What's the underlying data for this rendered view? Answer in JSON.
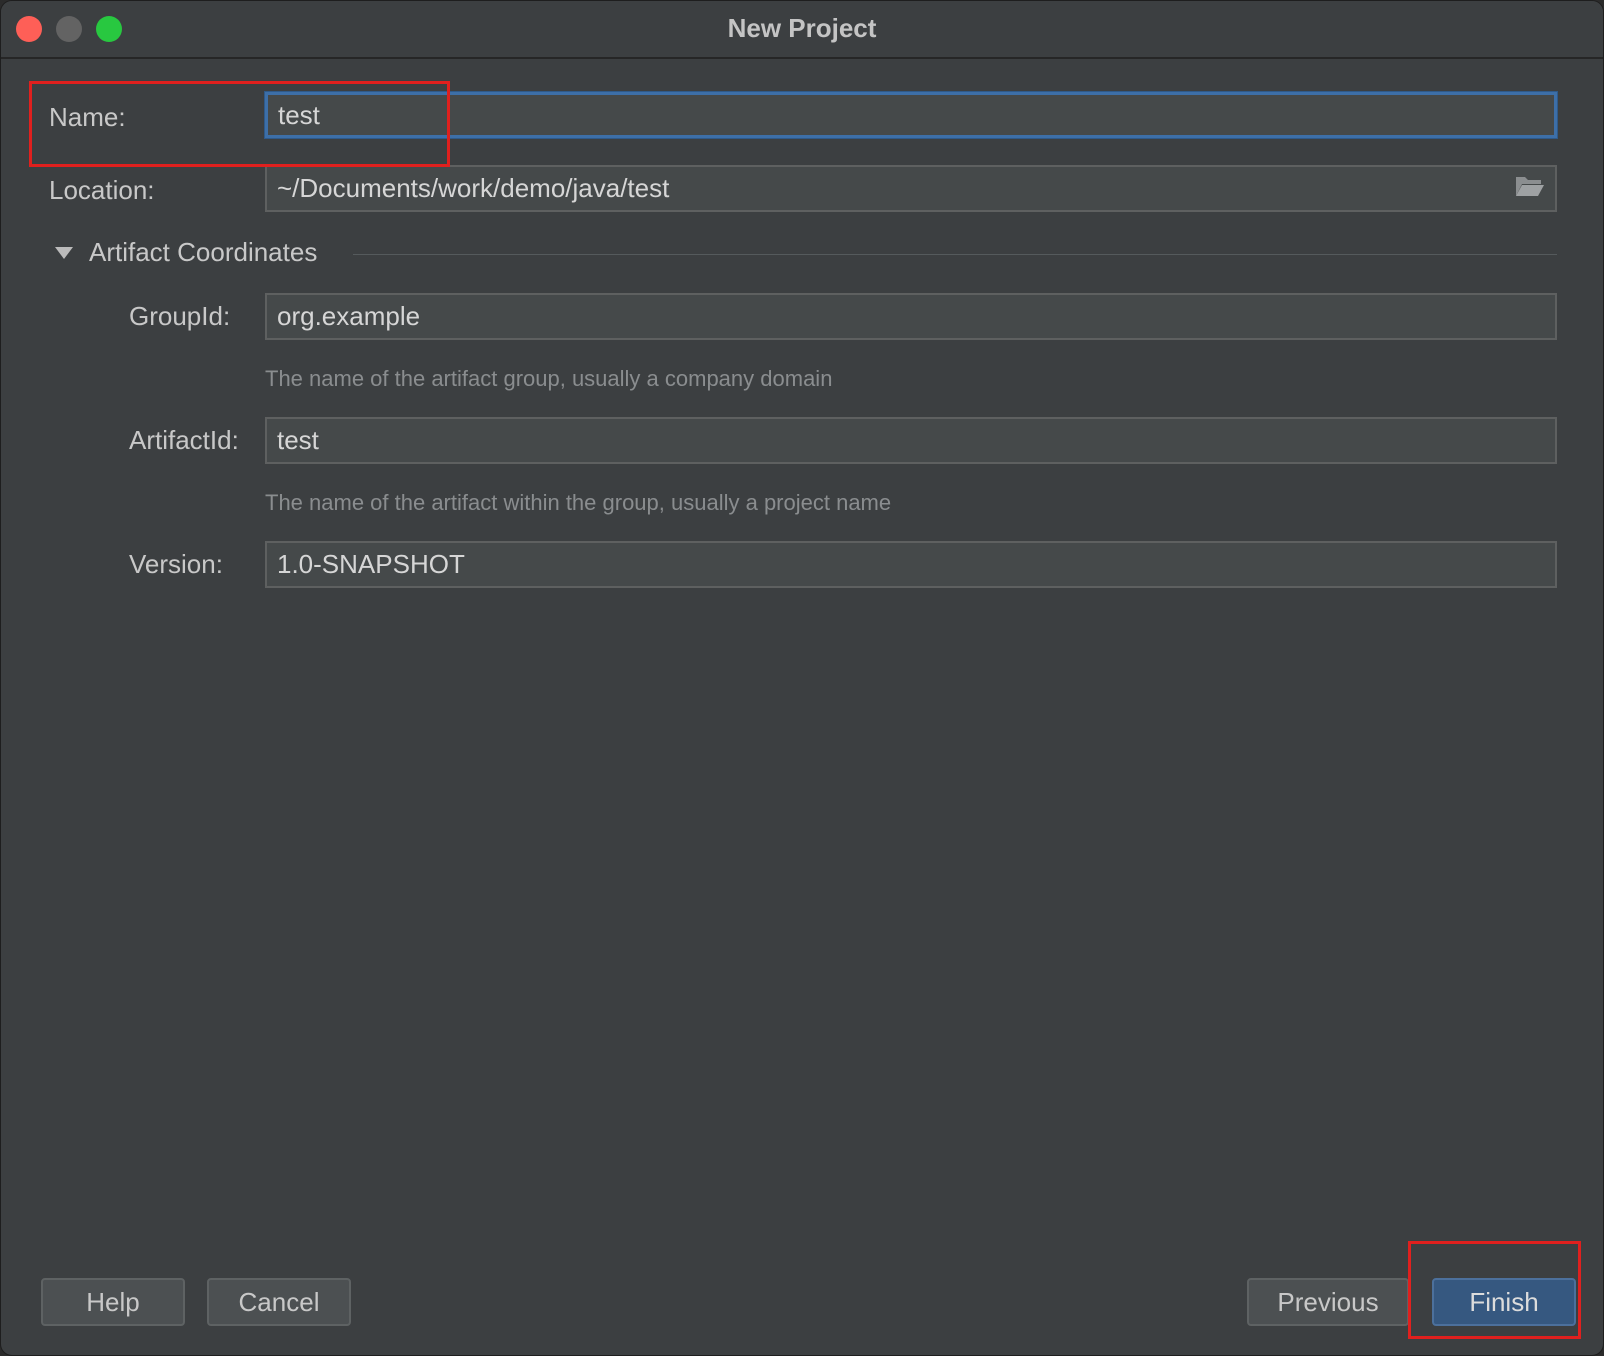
{
  "window": {
    "title": "New Project"
  },
  "form": {
    "name_label": "Name:",
    "name_value": "test",
    "location_label": "Location:",
    "location_value": "~/Documents/work/demo/java/test",
    "section_title": "Artifact Coordinates",
    "groupid_label": "GroupId:",
    "groupid_value": "org.example",
    "groupid_hint": "The name of the artifact group, usually a company domain",
    "artifactid_label": "ArtifactId:",
    "artifactid_value": "test",
    "artifactid_hint": "The name of the artifact within the group, usually a project name",
    "version_label": "Version:",
    "version_value": "1.0-SNAPSHOT"
  },
  "buttons": {
    "help": "Help",
    "cancel": "Cancel",
    "previous": "Previous",
    "finish": "Finish"
  },
  "colors": {
    "background": "#3c3f41",
    "field_background": "#45494a",
    "focus_border": "#3d6fa8",
    "primary_button": "#365880",
    "annotation": "#e0201e"
  },
  "icons": {
    "location_browse": "folder-open-icon",
    "section_toggle": "triangle-down-icon"
  }
}
